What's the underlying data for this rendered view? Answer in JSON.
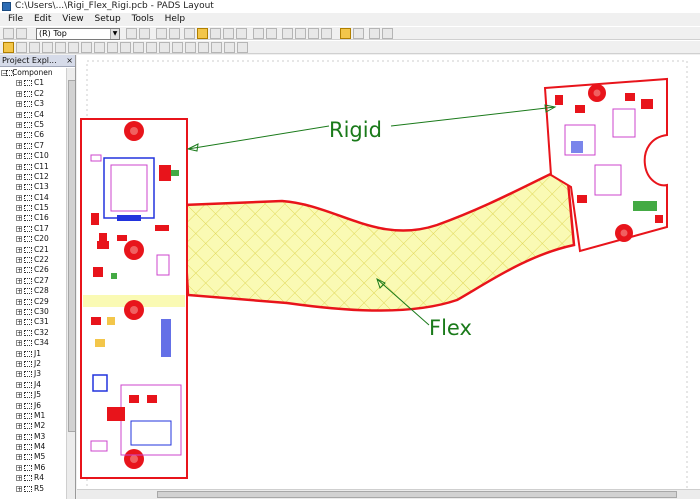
{
  "window": {
    "title": "C:\\Users\\...\\Rigi_Flex_Rigi.pcb - PADS Layout"
  },
  "menu": [
    "File",
    "Edit",
    "View",
    "Setup",
    "Tools",
    "Help"
  ],
  "toolbar": {
    "layer_value": "(R) Top"
  },
  "project_explorer": {
    "title": "Project Expl...",
    "close_glyph": "×",
    "root": "Componen",
    "items": [
      "C1",
      "C2",
      "C3",
      "C4",
      "C5",
      "C6",
      "C7",
      "C10",
      "C11",
      "C12",
      "C13",
      "C14",
      "C15",
      "C16",
      "C17",
      "C20",
      "C21",
      "C22",
      "C26",
      "C27",
      "C28",
      "C29",
      "C30",
      "C31",
      "C32",
      "C34",
      "J1",
      "J2",
      "J3",
      "J4",
      "J5",
      "J6",
      "M1",
      "M2",
      "M3",
      "M4",
      "M5",
      "M6",
      "R4",
      "R5"
    ]
  },
  "annotations": {
    "rigid": "Rigid",
    "flex": "Flex"
  },
  "colors": {
    "board_outline": "#e8141b",
    "flex_fill": "#fafab4",
    "flex_hatch": "#e8e060",
    "annotation_text": "#1a7a1a",
    "annotation_line": "#1a7a1a",
    "pad_red": "#e8141b",
    "silk_magenta": "#cc44cc",
    "silk_blue": "#2233dd"
  }
}
